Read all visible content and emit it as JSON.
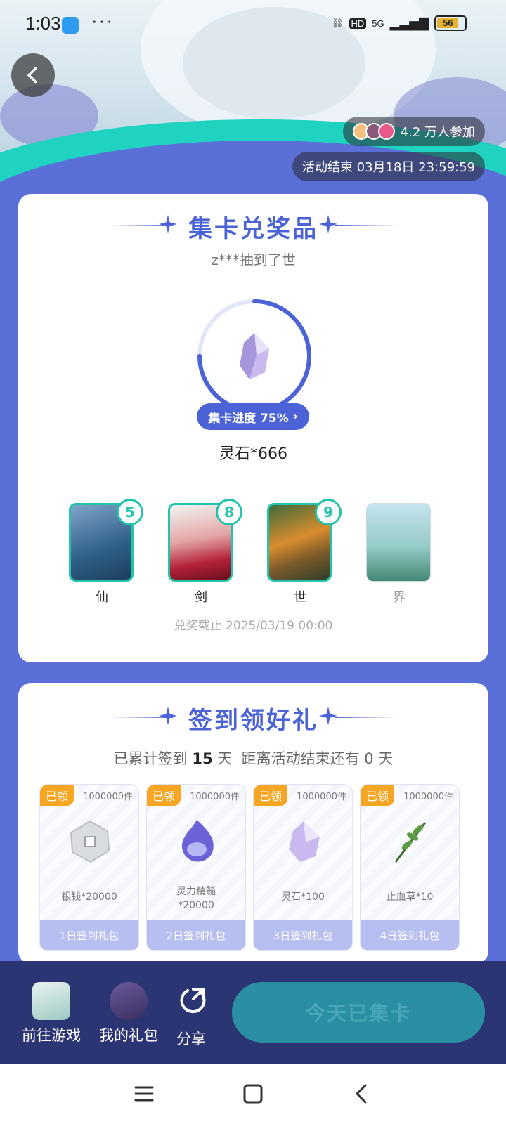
{
  "status_bar": {
    "time": "1:03",
    "dots": "···",
    "network": "5G",
    "hd": "HD",
    "battery": "56"
  },
  "hero": {
    "participants": "4.2 万人参加",
    "activity_end": "活动结束 03月18日 23:59:59"
  },
  "card_collect": {
    "title": "集卡兑奖品",
    "ticker": "z***抽到了世",
    "progress_label": "集卡进度 75%",
    "progress_value": 0.75,
    "reward": "灵石*666",
    "cards": [
      {
        "name": "仙",
        "count": "5",
        "collected": true
      },
      {
        "name": "剑",
        "count": "8",
        "collected": true
      },
      {
        "name": "世",
        "count": "9",
        "collected": true
      },
      {
        "name": "界",
        "count": "",
        "collected": false
      }
    ],
    "deadline": "兑奖截止 2025/03/19 00:00"
  },
  "card_signin": {
    "title": "签到领好礼",
    "summary_prefix": "已累计签到",
    "summary_days": "15",
    "summary_mid": "天  距离活动结束还有",
    "summary_remaining": "0",
    "summary_suffix": "天",
    "gifts": [
      {
        "tag": "已领",
        "qty": "1000000件",
        "item": "银钱*20000",
        "day": "1日签到礼包"
      },
      {
        "tag": "已领",
        "qty": "1000000件",
        "item_line1": "灵力精髓",
        "item_line2": "*20000",
        "day": "2日签到礼包"
      },
      {
        "tag": "已领",
        "qty": "1000000件",
        "item": "灵石*100",
        "day": "3日签到礼包"
      },
      {
        "tag": "已领",
        "qty": "1000000件",
        "item": "止血草*10",
        "day": "4日签到礼包"
      }
    ]
  },
  "bottom_bar": {
    "go_game": "前往游戏",
    "my_gifts": "我的礼包",
    "share": "分享",
    "collect_button": "今天已集卡"
  },
  "colors": {
    "primary": "#4b63d6",
    "teal": "#24c4ac",
    "tag": "#f6a623",
    "bottom_bar": "#2b3574"
  }
}
